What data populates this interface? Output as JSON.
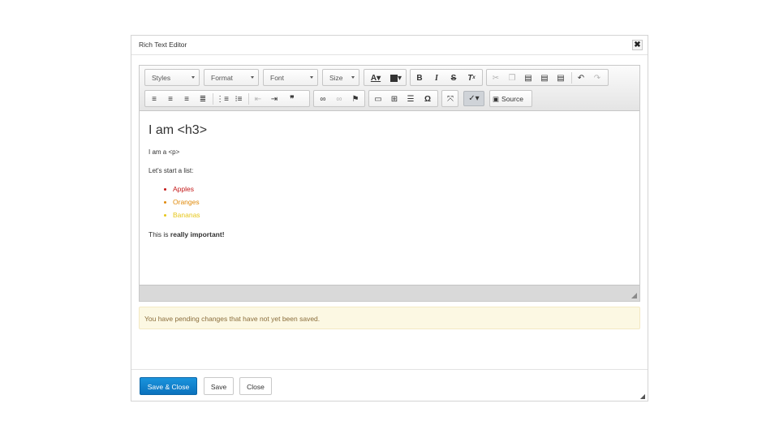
{
  "dialog": {
    "title": "Rich Text Editor",
    "close_icon": "close-icon"
  },
  "toolbar": {
    "combos": {
      "styles": "Styles",
      "format": "Format",
      "font": "Font",
      "size": "Size"
    },
    "source_label": "Source",
    "icons": {
      "text_color": "text-color-icon",
      "background_color": "background-color-icon",
      "bold": "bold-icon",
      "italic": "italic-icon",
      "strike": "strikethrough-icon",
      "remove_format": "remove-format-icon",
      "cut": "cut-icon",
      "copy": "copy-icon",
      "paste": "paste-icon",
      "paste_text": "paste-text-icon",
      "paste_word": "paste-from-word-icon",
      "undo": "undo-icon",
      "redo": "redo-icon",
      "align_left": "align-left-icon",
      "align_center": "align-center-icon",
      "align_right": "align-right-icon",
      "justify": "justify-icon",
      "numbered_list": "numbered-list-icon",
      "bulleted_list": "bulleted-list-icon",
      "outdent": "outdent-icon",
      "indent": "indent-icon",
      "blockquote": "blockquote-icon",
      "link": "link-icon",
      "unlink": "unlink-icon",
      "anchor": "anchor-icon",
      "image": "image-icon",
      "table": "table-icon",
      "horizontal_rule": "horizontal-rule-icon",
      "special_char": "special-character-icon",
      "maximize": "maximize-icon",
      "spellcheck": "spellcheck-icon",
      "source": "source-icon"
    }
  },
  "content": {
    "heading": "I am <h3>",
    "paragraph1": "I am a <p>",
    "paragraph2": "Let's start a list:",
    "list": [
      {
        "text": "Apples",
        "color": "#c41a1a"
      },
      {
        "text": "Oranges",
        "color": "#e08a0b"
      },
      {
        "text": "Bananas",
        "color": "#e6c619"
      }
    ],
    "important_prefix": "This is ",
    "important_bold": "really important!"
  },
  "alert": {
    "message": "You have pending changes that have not yet been saved."
  },
  "footer": {
    "save_close": "Save & Close",
    "save": "Save",
    "close": "Close"
  },
  "colors": {
    "primary_button": "#0b72bd",
    "alert_background": "#fcf8e3",
    "alert_text": "#8a6d3b"
  }
}
